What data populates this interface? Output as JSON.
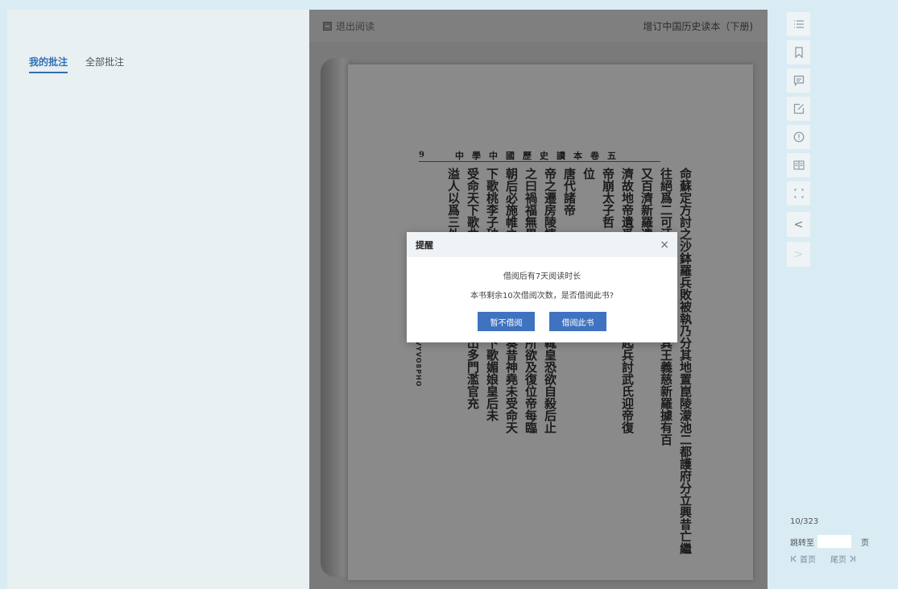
{
  "annotations": {
    "tabs": [
      {
        "label": "我的批注",
        "active": true
      },
      {
        "label": "全部批注",
        "active": false
      }
    ]
  },
  "reader": {
    "exit_label": "退出阅读",
    "book_title": "增订中国历史读本（下册)"
  },
  "page": {
    "page_number": "9",
    "header": "中學中國歷史讀本卷五",
    "side_stamp": "ZOCO3CVYVO8PHO",
    "columns": [
      "命蘇定方討之沙鉢羅兵敗被執乃分其地置崑陵濛池二都護府分立興昔亡繼",
      "往絕爲二可汗使蘇定方伐百濟唐其王義慈新羅據有百",
      "又百濟新羅遣使謝罪",
      "濟故地帝遺爲盧陵王及張柬之等起兵討武氏迎帝復",
      "帝崩太子哲",
      "位",
      "唐代諸帝",
      "帝之遷房陵情愛甚篤每聞敕使至輒皇恐欲自殺后止",
      "之曰禍福無異時復見天日當惟卿所欲及復位帝每臨",
      "朝后必施帷之世矣沙門迦葉志忠奏昔神堯未受命天",
      "下歌桃李子破陣樂則天未受命天下歌媚娘皇后未",
      "受命天下歌曲皇后宜則奏之時政出多門濫官充",
      "溢人以爲三外官也"
    ]
  },
  "dialog": {
    "title": "提醒",
    "close": "×",
    "message1": "借阅后有7天阅读时长",
    "message2": "本书剩余10次借阅次数，是否借阅此书?",
    "cancel_label": "暂不借阅",
    "confirm_label": "借阅此书"
  },
  "toolbar": {
    "tools": [
      "list-icon",
      "bookmark-icon",
      "note-icon",
      "edit-icon",
      "warning-icon",
      "book-icon",
      "fullscreen-icon"
    ],
    "prev": "<",
    "next": ">"
  },
  "pagination": {
    "current": "10/323",
    "jump_label": "跳转至",
    "jump_value": "",
    "jump_unit": "页",
    "first_label": "首页",
    "last_label": "尾页"
  }
}
